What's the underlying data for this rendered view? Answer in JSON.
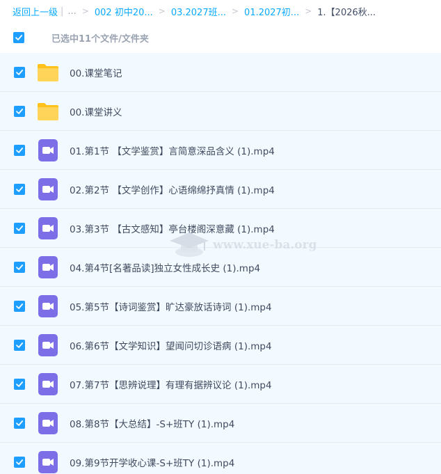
{
  "breadcrumb": {
    "back": "返回上一级",
    "dots": "...",
    "items": [
      "002 初中20...",
      "03.2027班...",
      "01.2027初..."
    ],
    "current": "1.【2026秋..."
  },
  "selection": {
    "status": "已选中11个文件/文件夹"
  },
  "files": [
    {
      "name": "00.课堂笔记",
      "icon": "folder-icon"
    },
    {
      "name": "00.课堂讲义",
      "icon": "folder-icon"
    },
    {
      "name": "01.第1节 【文学鉴赏】言简意深品含义 (1).mp4",
      "icon": "video-file-icon"
    },
    {
      "name": "02.第2节 【文学创作】心语绵绵抒真情 (1).mp4",
      "icon": "video-file-icon"
    },
    {
      "name": "03.第3节 【古文感知】亭台楼阁深意藏 (1).mp4",
      "icon": "video-file-icon"
    },
    {
      "name": "04.第4节[名著品读]独立女性成长史 (1).mp4",
      "icon": "video-file-icon"
    },
    {
      "name": "05.第5节【诗词鉴赏】旷达豪放话诗词 (1).mp4",
      "icon": "video-file-icon"
    },
    {
      "name": "06.第6节【文学知识】望闻问切诊语病 (1).mp4",
      "icon": "video-file-icon"
    },
    {
      "name": "07.第7节【思辨说理】有理有据辨议论 (1).mp4",
      "icon": "video-file-icon"
    },
    {
      "name": "08.第8节【大总结】-S+班TY (1).mp4",
      "icon": "video-file-icon"
    },
    {
      "name": "09.第9节开学收心课-S+班TY (1).mp4",
      "icon": "video-file-icon"
    }
  ],
  "watermark": "www.xue-ba.org",
  "colors": {
    "link": "#09aaff",
    "checkbox": "#1e9fff",
    "row_bg": "#f3faff",
    "folder": "#ffcd42",
    "video_icon": "#7b6ee6"
  }
}
